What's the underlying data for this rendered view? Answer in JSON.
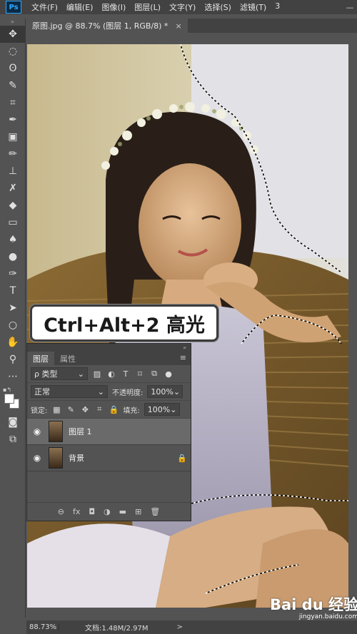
{
  "app": {
    "logo": "Ps"
  },
  "menu": [
    "文件(F)",
    "编辑(E)",
    "图像(I)",
    "图层(L)",
    "文字(Y)",
    "选择(S)",
    "滤镜(T)",
    "3"
  ],
  "window_controls": [
    "—"
  ],
  "tab": {
    "title": "原图.jpg @ 88.7% (图层 1, RGB/8) *",
    "close": "×"
  },
  "tools": [
    {
      "name": "move-tool",
      "icon": "✥"
    },
    {
      "name": "marquee-tool",
      "icon": "◌"
    },
    {
      "name": "lasso-tool",
      "icon": "ʘ"
    },
    {
      "name": "quick-select-tool",
      "icon": "✎"
    },
    {
      "name": "crop-tool",
      "icon": "⌗"
    },
    {
      "name": "eyedropper-tool",
      "icon": "✒"
    },
    {
      "name": "frame-tool",
      "icon": "▣"
    },
    {
      "name": "brush-tool",
      "icon": "✏"
    },
    {
      "name": "stamp-tool",
      "icon": "⊥"
    },
    {
      "name": "history-brush-tool",
      "icon": "✗"
    },
    {
      "name": "eraser-tool",
      "icon": "◆"
    },
    {
      "name": "gradient-tool",
      "icon": "▭"
    },
    {
      "name": "blur-tool",
      "icon": "♠"
    },
    {
      "name": "dodge-tool",
      "icon": "●"
    },
    {
      "name": "pen-tool",
      "icon": "✑"
    },
    {
      "name": "type-tool",
      "icon": "T"
    },
    {
      "name": "path-select-tool",
      "icon": "➤"
    },
    {
      "name": "ellipse-tool",
      "icon": "○"
    },
    {
      "name": "hand-tool",
      "icon": "✋"
    },
    {
      "name": "zoom-tool",
      "icon": "⚲"
    },
    {
      "name": "more-tools",
      "icon": "⋯"
    }
  ],
  "toolbar_bottom": [
    {
      "name": "quick-mask-button",
      "icon": "◙"
    },
    {
      "name": "screen-mode-button",
      "icon": "⧉"
    }
  ],
  "callout": {
    "text": "Ctrl+Alt+2 高光"
  },
  "layers_panel": {
    "collapse": "»",
    "tabs": [
      "图层",
      "属性"
    ],
    "menu_icon": "≡",
    "filter_label": "ρ 类型",
    "blend_mode": "正常",
    "opacity_label": "不透明度:",
    "opacity_value": "100%",
    "lock_label": "锁定:",
    "fill_label": "填充:",
    "fill_value": "100%",
    "layers": [
      {
        "name": "图层 1",
        "selected": true,
        "locked": false
      },
      {
        "name": "背景",
        "selected": false,
        "locked": true
      }
    ],
    "footer_icons": [
      "⊖",
      "fx",
      "◘",
      "◑",
      "▬",
      "⊞",
      "🗑"
    ]
  },
  "status": {
    "zoom": "88.73%",
    "doc": "文档:1.48M/2.97M",
    "arrow": ">"
  },
  "watermark": {
    "logo": "Bai du 经验",
    "url": "jingyan.baidu.com"
  },
  "colors": {
    "bg": "#535353",
    "menubar": "#424242",
    "accent": "#31a8ff"
  }
}
